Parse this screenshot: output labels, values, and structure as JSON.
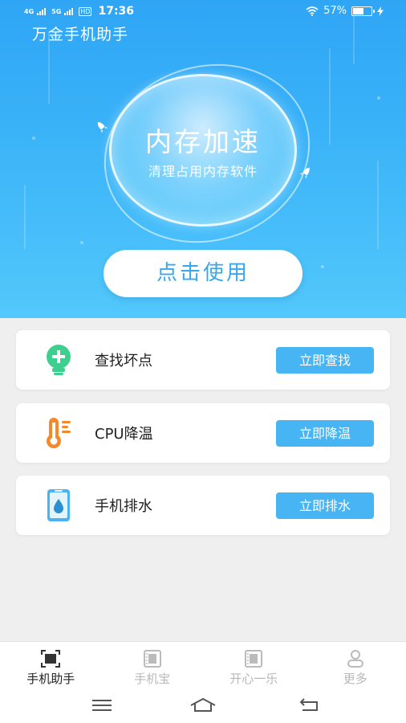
{
  "status_bar": {
    "signal_1": "4G",
    "signal_2": "5G",
    "hd": "HD",
    "time": "17:36",
    "battery_percent": "57%",
    "battery_level": 0.55
  },
  "app": {
    "title": "万金手机助手"
  },
  "hero": {
    "title": "内存加速",
    "subtitle": "清理占用内存软件",
    "action_label": "点击使用"
  },
  "tools": [
    {
      "label": "查找坏点",
      "action": "立即查找",
      "icon": "plus-bulb-icon"
    },
    {
      "label": "CPU降温",
      "action": "立即降温",
      "icon": "thermometer-icon"
    },
    {
      "label": "手机排水",
      "action": "立即排水",
      "icon": "phone-water-drop-icon"
    }
  ],
  "tabs": [
    {
      "label": "手机助手",
      "active": true,
      "icon": "scan-frame-icon"
    },
    {
      "label": "手机宝",
      "active": false,
      "icon": "film-frame-icon"
    },
    {
      "label": "开心一乐",
      "active": false,
      "icon": "film-frame-icon"
    },
    {
      "label": "更多",
      "active": false,
      "icon": "person-icon"
    }
  ],
  "colors": {
    "accent": "#47b4f4",
    "hero_top": "#2fa5f5",
    "hero_bottom": "#52c8fb",
    "button_text": "#3aa7ec"
  }
}
